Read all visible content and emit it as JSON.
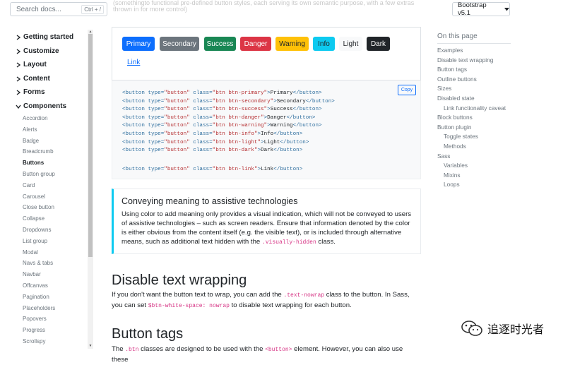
{
  "search": {
    "placeholder": "Search docs...",
    "shortcut": "Ctrl + /"
  },
  "version": {
    "label": "Bootstrap v5.1"
  },
  "faded_text": "(somethingto functional pre-defined button styles, each serving its own semantic purpose, with a few extras thrown in for more control)",
  "sidebar": {
    "groups": [
      {
        "label": "Getting started"
      },
      {
        "label": "Customize"
      },
      {
        "label": "Layout"
      },
      {
        "label": "Content"
      },
      {
        "label": "Forms"
      },
      {
        "label": "Components"
      }
    ],
    "components": [
      "Accordion",
      "Alerts",
      "Badge",
      "Breadcrumb",
      "Buttons",
      "Button group",
      "Card",
      "Carousel",
      "Close button",
      "Collapse",
      "Dropdowns",
      "List group",
      "Modal",
      "Navs & tabs",
      "Navbar",
      "Offcanvas",
      "Pagination",
      "Placeholders",
      "Popovers",
      "Progress",
      "Scrollspy"
    ],
    "active": "Buttons"
  },
  "buttons": [
    {
      "label": "Primary",
      "bg": "#0d6efd",
      "fg": "#ffffff"
    },
    {
      "label": "Secondary",
      "bg": "#6c757d",
      "fg": "#ffffff"
    },
    {
      "label": "Success",
      "bg": "#198754",
      "fg": "#ffffff"
    },
    {
      "label": "Danger",
      "bg": "#dc3545",
      "fg": "#ffffff"
    },
    {
      "label": "Warning",
      "bg": "#ffc107",
      "fg": "#212529"
    },
    {
      "label": "Info",
      "bg": "#0dcaf0",
      "fg": "#212529"
    },
    {
      "label": "Light",
      "bg": "#f8f9fa",
      "fg": "#212529"
    },
    {
      "label": "Dark",
      "bg": "#212529",
      "fg": "#ffffff"
    }
  ],
  "link_button": "Link",
  "code": {
    "copy": "Copy",
    "lines": [
      {
        "cls": "btn btn-primary",
        "text": "Primary"
      },
      {
        "cls": "btn btn-secondary",
        "text": "Secondary"
      },
      {
        "cls": "btn btn-success",
        "text": "Success"
      },
      {
        "cls": "btn btn-danger",
        "text": "Danger"
      },
      {
        "cls": "btn btn-warning",
        "text": "Warning"
      },
      {
        "cls": "btn btn-info",
        "text": "Info"
      },
      {
        "cls": "btn btn-light",
        "text": "Light"
      },
      {
        "cls": "btn btn-dark",
        "text": "Dark"
      },
      {
        "cls": "btn btn-link",
        "text": "Link"
      }
    ]
  },
  "callout": {
    "title": "Conveying meaning to assistive technologies",
    "text_before": "Using color to add meaning only provides a visual indication, which will not be conveyed to users of assistive technologies – such as screen readers. Ensure that information denoted by the color is either obvious from the content itself (e.g. the visible text), or is included through alternative means, such as additional text hidden with the ",
    "code": ".visually-hidden",
    "text_after": " class."
  },
  "section1": {
    "title": "Disable text wrapping",
    "p_a": "If you don't want the button text to wrap, you can add the ",
    "code_a": ".text-nowrap",
    "p_b": " class to the button. In Sass, you can set ",
    "code_b": "$btn-white-space: nowrap",
    "p_c": " to disable text wrapping for each button."
  },
  "section2": {
    "title": "Button tags",
    "p_a": "The ",
    "code_a": ".btn",
    "p_b": " classes are designed to be used with the ",
    "code_b": "<button>",
    "p_c": " element. However, you can also use these"
  },
  "on_this_page": {
    "title": "On this page",
    "items": [
      {
        "label": "Examples",
        "level": 1
      },
      {
        "label": "Disable text wrapping",
        "level": 1
      },
      {
        "label": "Button tags",
        "level": 1
      },
      {
        "label": "Outline buttons",
        "level": 1
      },
      {
        "label": "Sizes",
        "level": 1
      },
      {
        "label": "Disabled state",
        "level": 1
      },
      {
        "label": "Link functionality caveat",
        "level": 2
      },
      {
        "label": "Block buttons",
        "level": 1
      },
      {
        "label": "Button plugin",
        "level": 1
      },
      {
        "label": "Toggle states",
        "level": 2
      },
      {
        "label": "Methods",
        "level": 2
      },
      {
        "label": "Sass",
        "level": 1
      },
      {
        "label": "Variables",
        "level": 2
      },
      {
        "label": "Mixins",
        "level": 2
      },
      {
        "label": "Loops",
        "level": 2
      }
    ]
  },
  "watermark": {
    "text": "追逐时光者",
    "icon": "wechat-icon"
  }
}
